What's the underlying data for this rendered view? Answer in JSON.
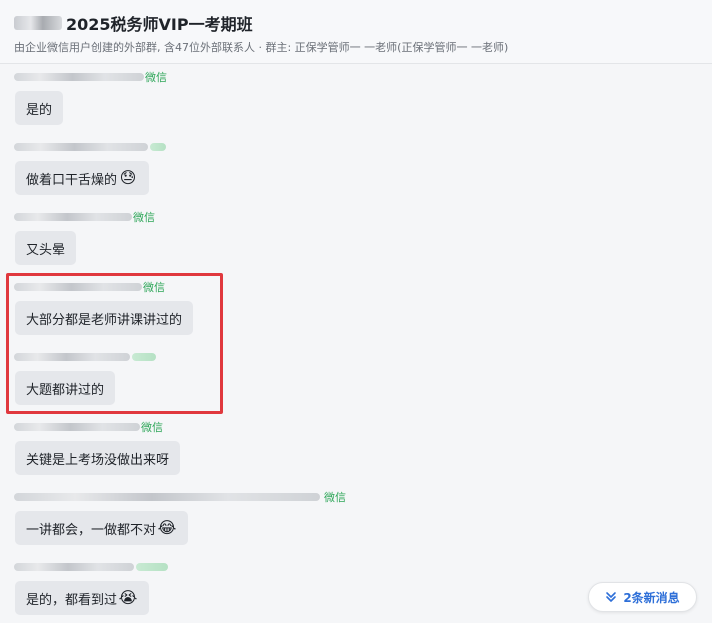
{
  "header": {
    "title": "2025税务师VIP一考期班",
    "subtitle": "由企业微信用户创建的外部群, 含47位外部联系人 · 群主: 正保学管师一 一老师(正保学管师一 一老师)"
  },
  "messages": [
    {
      "sender_tag": "微信",
      "text": "是的",
      "emoji": ""
    },
    {
      "sender_tag": "",
      "text": "做着口干舌燥的",
      "emoji": "😓"
    },
    {
      "sender_tag": "微信",
      "text": "又头晕",
      "emoji": ""
    },
    {
      "sender_tag": "微信",
      "text": "大部分都是老师讲课讲过的",
      "emoji": ""
    },
    {
      "sender_tag": "",
      "text": "大题都讲过的",
      "emoji": ""
    },
    {
      "sender_tag": "微信",
      "text": "关键是上考场没做出来呀",
      "emoji": ""
    },
    {
      "sender_tag": "微信",
      "text": "一讲都会，一做都不对",
      "emoji": "😂"
    },
    {
      "sender_tag": "",
      "text": "是的，都看到过",
      "emoji": "😭"
    }
  ],
  "new_messages_button": {
    "label": "2条新消息",
    "icon": "double-chevron-down-icon"
  },
  "colors": {
    "highlight_border": "#e0383e",
    "wechat_tag": "#2ea659",
    "bubble_bg": "#e5e7eb",
    "link_blue": "#2e6fd8"
  }
}
